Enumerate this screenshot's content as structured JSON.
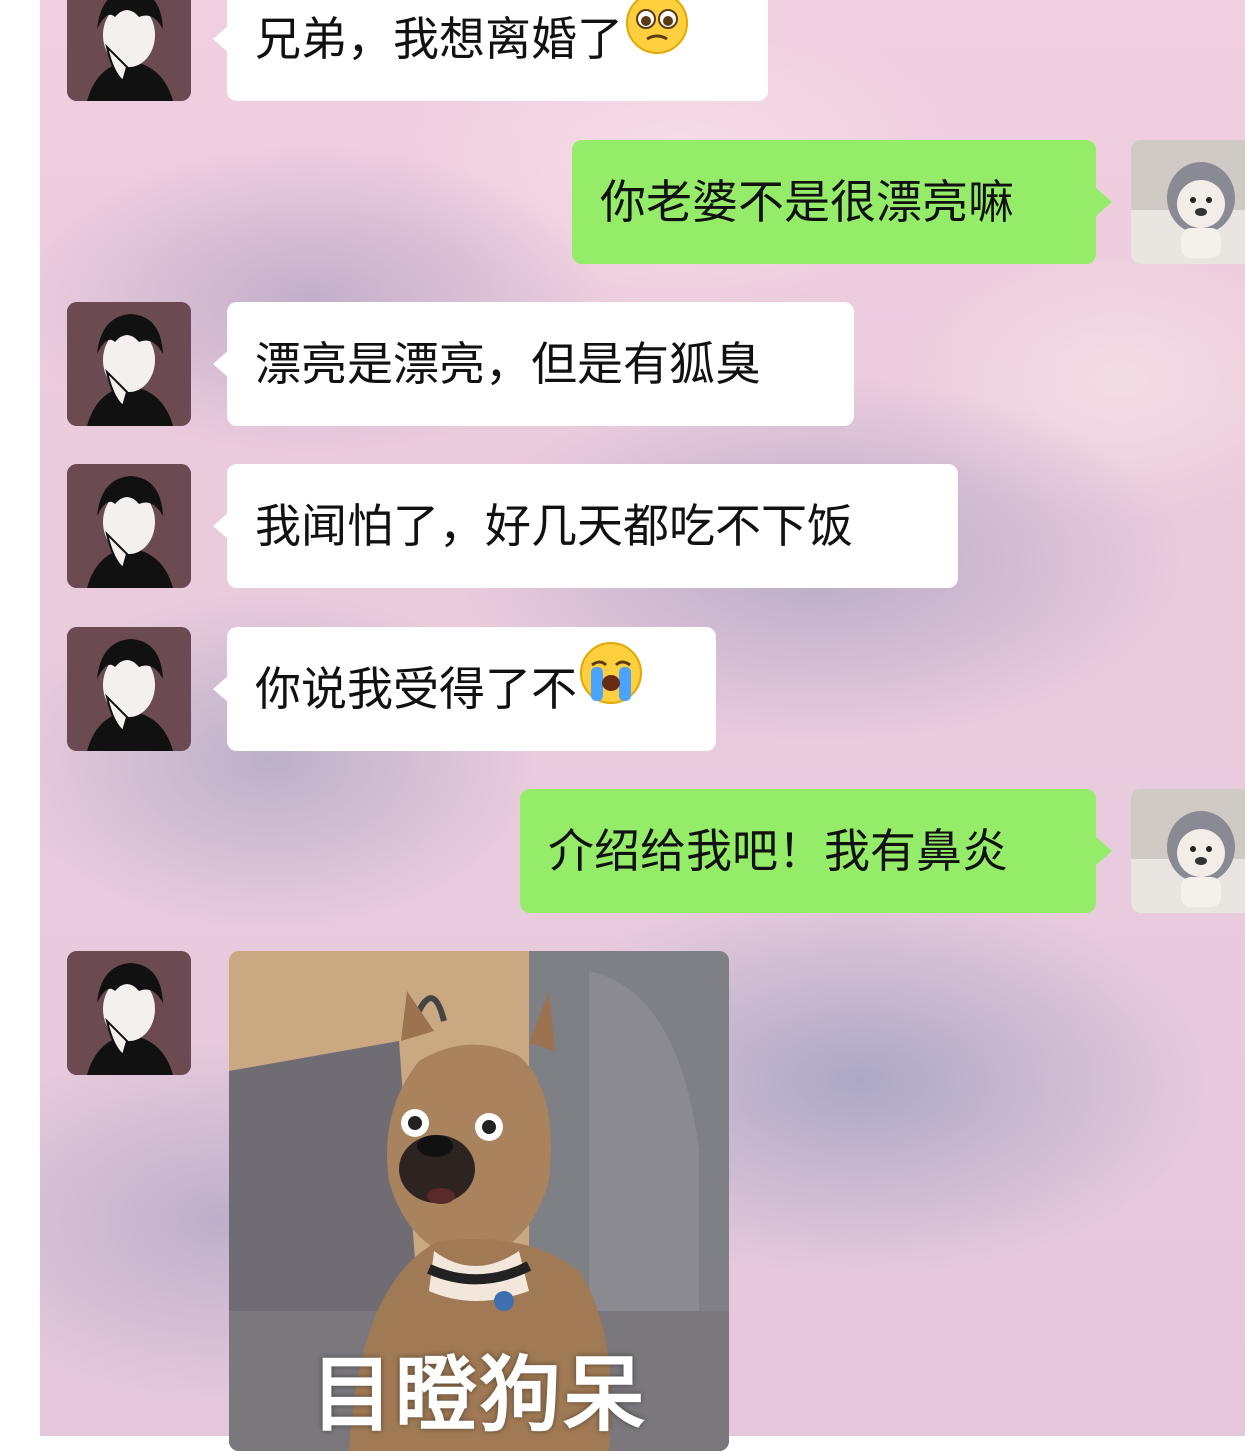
{
  "messages": [
    {
      "side": "in",
      "text": "兄弟，我想离婚了",
      "emoji": "pleading-face-icon"
    },
    {
      "side": "out",
      "text": "你老婆不是很漂亮嘛"
    },
    {
      "side": "in",
      "text": "漂亮是漂亮，但是有狐臭"
    },
    {
      "side": "in",
      "text": "我闻怕了，好几天都吃不下饭"
    },
    {
      "side": "in",
      "text": "你说我受得了不",
      "emoji": "loudly-crying-face-icon"
    },
    {
      "side": "out",
      "text": "介绍给我吧！我有鼻炎"
    },
    {
      "side": "in",
      "type": "sticker",
      "caption": "目瞪狗呆"
    }
  ],
  "colors": {
    "incoming_bubble": "#ffffff",
    "outgoing_bubble": "#95ec69",
    "text": "#111111"
  }
}
